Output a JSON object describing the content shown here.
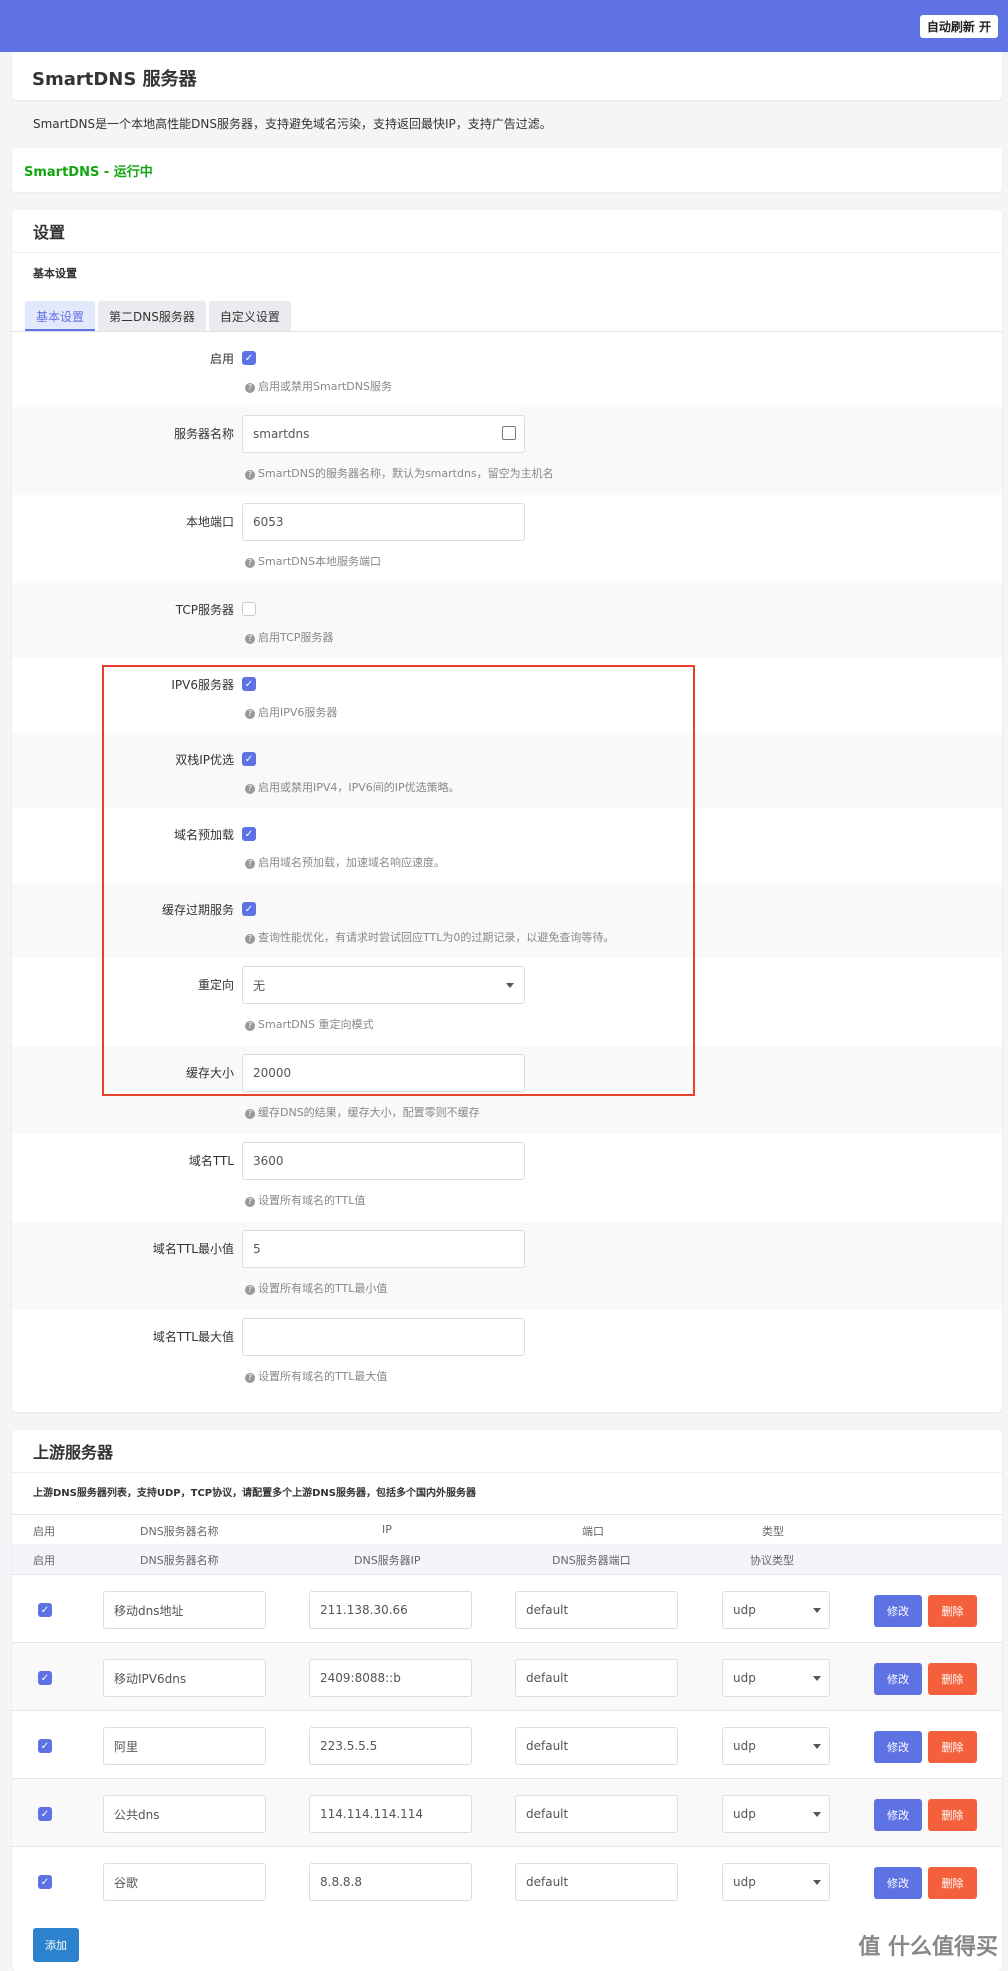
{
  "header": {
    "autorefresh": "自动刷新 开"
  },
  "page": {
    "title": "SmartDNS 服务器",
    "description": "SmartDNS是一个本地高性能DNS服务器，支持避免域名污染，支持返回最快IP，支持广告过滤。",
    "status": "SmartDNS - 运行中"
  },
  "settings": {
    "title": "设置",
    "subtitle": "基本设置",
    "tabs": [
      "基本设置",
      "第二DNS服务器",
      "自定义设置"
    ],
    "fields": {
      "enable": {
        "label": "启用",
        "help": "启用或禁用SmartDNS服务",
        "checked": true
      },
      "server_name": {
        "label": "服务器名称",
        "value": "smartdns",
        "help": "SmartDNS的服务器名称，默认为smartdns，留空为主机名"
      },
      "local_port": {
        "label": "本地端口",
        "value": "6053",
        "help": "SmartDNS本地服务端口"
      },
      "tcp_server": {
        "label": "TCP服务器",
        "help": "启用TCP服务器",
        "checked": false
      },
      "ipv6_server": {
        "label": "IPV6服务器",
        "help": "启用IPV6服务器",
        "checked": true
      },
      "dualstack": {
        "label": "双栈IP优选",
        "help": "启用或禁用IPV4，IPV6间的IP优选策略。",
        "checked": true
      },
      "prefetch": {
        "label": "域名预加载",
        "help": "启用域名预加载，加速域名响应速度。",
        "checked": true
      },
      "serve_expired": {
        "label": "缓存过期服务",
        "help": "查询性能优化，有请求时尝试回应TTL为0的过期记录，以避免查询等待。",
        "checked": true
      },
      "redirect": {
        "label": "重定向",
        "value": "无",
        "help": "SmartDNS 重定向模式"
      },
      "cache_size": {
        "label": "缓存大小",
        "value": "20000",
        "help": "缓存DNS的结果，缓存大小，配置零则不缓存"
      },
      "ttl": {
        "label": "域名TTL",
        "value": "3600",
        "help": "设置所有域名的TTL值"
      },
      "ttl_min": {
        "label": "域名TTL最小值",
        "value": "5",
        "help": "设置所有域名的TTL最小值"
      },
      "ttl_max": {
        "label": "域名TTL最大值",
        "value": "",
        "help": "设置所有域名的TTL最大值"
      }
    }
  },
  "upstream": {
    "title": "上游服务器",
    "description": "上游DNS服务器列表，支持UDP，TCP协议，请配置多个上游DNS服务器，包括多个国内外服务器",
    "header1": [
      "启用",
      "DNS服务器名称",
      "IP",
      "端口",
      "类型"
    ],
    "header2": [
      "启用",
      "DNS服务器名称",
      "DNS服务器IP",
      "DNS服务器端口",
      "协议类型"
    ],
    "rows": [
      {
        "name": "移动dns地址",
        "ip": "211.138.30.66",
        "port": "default",
        "type": "udp"
      },
      {
        "name": "移动IPV6dns",
        "ip": "2409:8088::b",
        "port": "default",
        "type": "udp"
      },
      {
        "name": "阿里",
        "ip": "223.5.5.5",
        "port": "default",
        "type": "udp"
      },
      {
        "name": "公共dns",
        "ip": "114.114.114.114",
        "port": "default",
        "type": "udp"
      },
      {
        "name": "谷歌",
        "ip": "8.8.8.8",
        "port": "default",
        "type": "udp"
      }
    ],
    "edit_label": "修改",
    "delete_label": "删除",
    "add_label": "添加"
  },
  "watermark": "值 什么值得买"
}
